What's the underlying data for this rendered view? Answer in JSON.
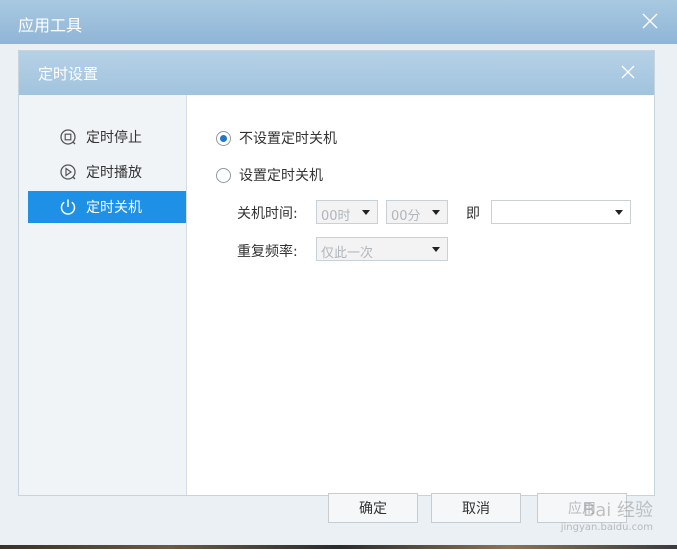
{
  "outer_window": {
    "title": "应用工具"
  },
  "dialog": {
    "title": "定时设置",
    "sidebar": [
      {
        "label": "定时停止",
        "icon": "stop-clock-icon",
        "active": false
      },
      {
        "label": "定时播放",
        "icon": "play-clock-icon",
        "active": false
      },
      {
        "label": "定时关机",
        "icon": "power-icon",
        "active": true
      }
    ],
    "options": {
      "no_shutdown": "不设置定时关机",
      "shutdown": "设置定时关机",
      "selected": "no_shutdown"
    },
    "shutdown_time": {
      "label": "关机时间:",
      "hour": "00时",
      "minute": "00分",
      "connector": "即",
      "date": ""
    },
    "repeat": {
      "label": "重复频率:",
      "value": "仅此一次"
    },
    "buttons": {
      "ok": "确定",
      "cancel": "取消",
      "apply": "应用"
    }
  },
  "watermark": {
    "text": "Bai 经验",
    "url": "jingyan.baidu.com"
  },
  "colors": {
    "accent": "#1e90e6",
    "title_bar": "#a2c3de",
    "sidebar_bg": "#f1f4f7"
  }
}
